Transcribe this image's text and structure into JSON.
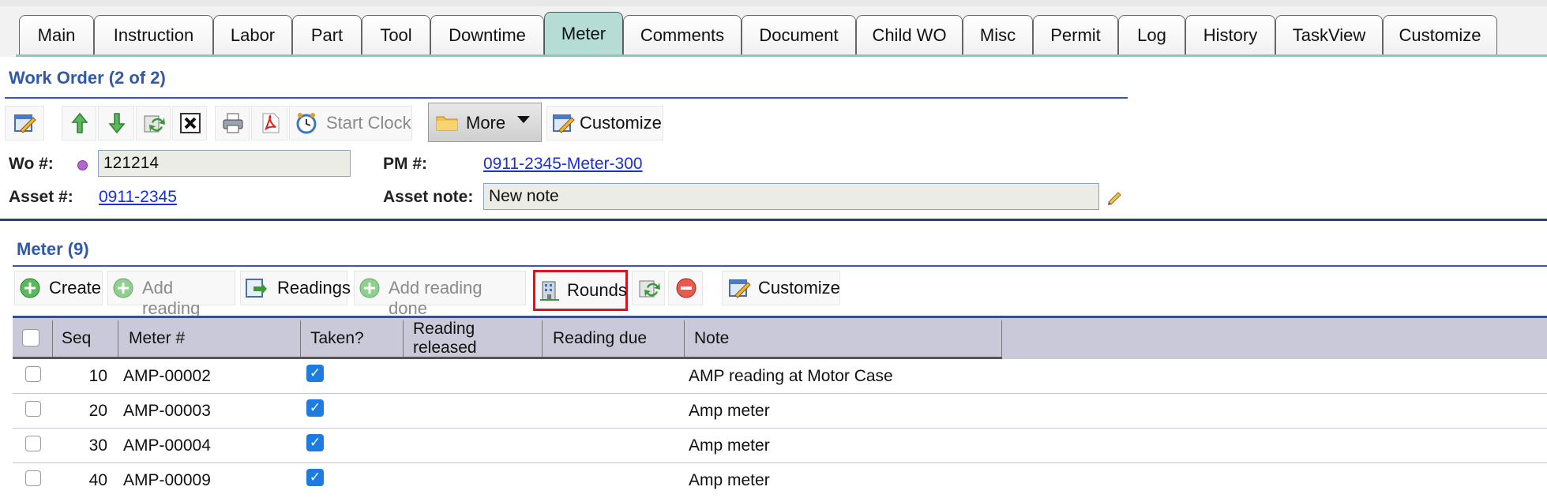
{
  "tabs": [
    "Main",
    "Instruction",
    "Labor",
    "Part",
    "Tool",
    "Downtime",
    "Meter",
    "Comments",
    "Document",
    "Child WO",
    "Misc",
    "Permit",
    "Log",
    "History",
    "TaskView",
    "Customize"
  ],
  "active_tab": "Meter",
  "work_order": {
    "title": "Work Order (2 of 2)",
    "toolbar": {
      "start_clock": "Start Clock",
      "more": "More",
      "customize": "Customize"
    },
    "fields": {
      "wo_label": "Wo #:",
      "wo_value": "121214",
      "pm_label": "PM #:",
      "pm_value": "0911-2345-Meter-300",
      "asset_label": "Asset #:",
      "asset_value": "0911-2345",
      "asset_note_label": "Asset note:",
      "asset_note_value": "New note"
    }
  },
  "meter": {
    "title": "Meter (9)",
    "toolbar": {
      "create": "Create",
      "add_reading": "Add reading",
      "readings": "Readings",
      "add_reading_done": "Add reading done",
      "rounds": "Rounds",
      "customize": "Customize"
    },
    "columns": {
      "seq": "Seq",
      "meter": "Meter #",
      "taken": "Taken?",
      "reading_released_1": "Reading",
      "reading_released_2": "released",
      "reading_due": "Reading due",
      "note": "Note"
    },
    "rows": [
      {
        "seq": "10",
        "meter": "AMP-00002",
        "taken": true,
        "note": "AMP reading at Motor Case"
      },
      {
        "seq": "20",
        "meter": "AMP-00003",
        "taken": true,
        "note": "Amp meter"
      },
      {
        "seq": "30",
        "meter": "AMP-00004",
        "taken": true,
        "note": "Amp meter"
      },
      {
        "seq": "40",
        "meter": "AMP-00009",
        "taken": true,
        "note": "Amp meter"
      }
    ]
  },
  "colors": {
    "active_tab": "#b6dcd6",
    "heading": "#2f5aaa",
    "link": "#1b2fd6",
    "highlight_box": "#e0101e",
    "checkbox_checked": "#1e7be0"
  }
}
